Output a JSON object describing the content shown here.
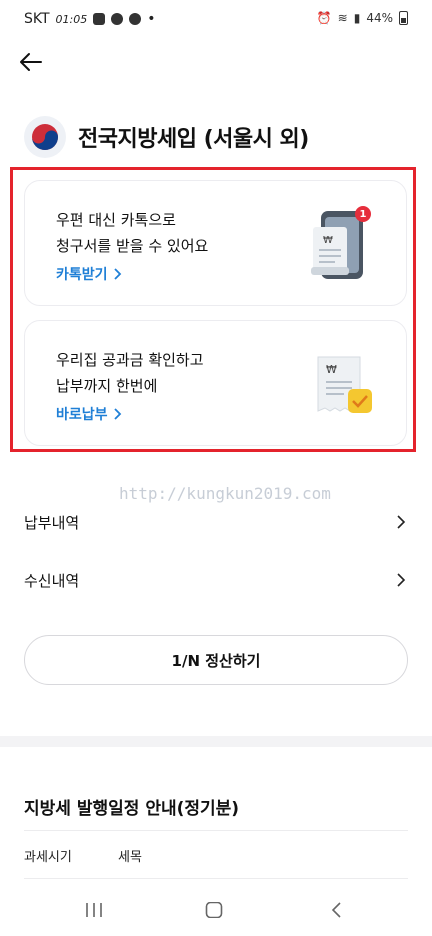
{
  "status": {
    "carrier": "SKT",
    "time": "01:05",
    "battery": "44%"
  },
  "page": {
    "title": "전국지방세입 (서울시 외)"
  },
  "cards": [
    {
      "line1": "우편 대신 카톡으로",
      "line2": "청구서를 받을 수 있어요",
      "link": "카톡받기",
      "badge": "1",
      "icon": "phone-bill-icon"
    },
    {
      "line1": "우리집 공과금 확인하고",
      "line2": "납부까지 한번에",
      "link": "바로납부",
      "icon": "receipt-check-icon"
    }
  ],
  "watermark": "http://kungkun2019.com",
  "menu": [
    {
      "label": "납부내역"
    },
    {
      "label": "수신내역"
    }
  ],
  "split_button": "1/N 정산하기",
  "schedule": {
    "title": "지방세 발행일정 안내(정기분)",
    "columns": [
      "과세시기",
      "세목"
    ]
  },
  "colors": {
    "accent_link": "#1f7fd6",
    "highlight_border": "#e4232c",
    "badge": "#e62e3c"
  }
}
